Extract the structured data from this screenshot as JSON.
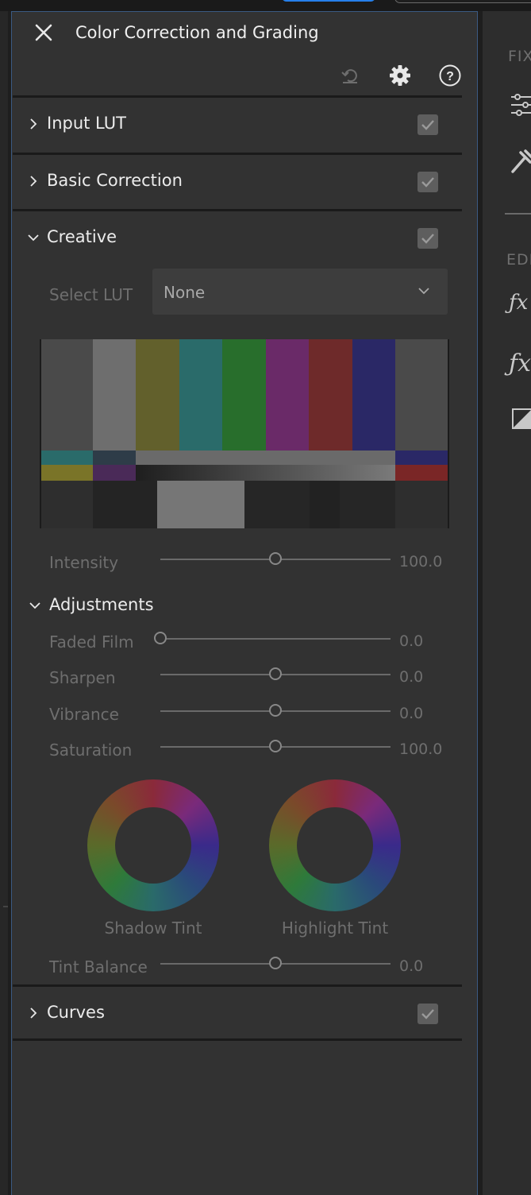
{
  "panel": {
    "title": "Color Correction and Grading",
    "header_icons": [
      "close-icon",
      "reset-icon",
      "gear-icon",
      "help-icon"
    ]
  },
  "sections": {
    "input_lut": {
      "label": "Input LUT",
      "enabled": true,
      "expanded": false
    },
    "basic_correction": {
      "label": "Basic Correction",
      "enabled": true,
      "expanded": false
    },
    "creative": {
      "label": "Creative",
      "enabled": true,
      "expanded": true,
      "select_lut": {
        "label": "Select LUT",
        "value": "None"
      },
      "intensity": {
        "label": "Intensity",
        "value": "100.0",
        "level": 0.5
      },
      "adjustments": {
        "label": "Adjustments",
        "faded_film": {
          "label": "Faded Film",
          "value": "0.0",
          "level": 0.0
        },
        "sharpen": {
          "label": "Sharpen",
          "value": "0.0",
          "level": 0.5
        },
        "vibrance": {
          "label": "Vibrance",
          "value": "0.0",
          "level": 0.5
        },
        "saturation": {
          "label": "Saturation",
          "value": "100.0",
          "level": 0.5
        },
        "shadow_tint": {
          "label": "Shadow Tint"
        },
        "highlight_tint": {
          "label": "Highlight Tint"
        },
        "tint_balance": {
          "label": "Tint Balance",
          "value": "0.0",
          "level": 0.5
        }
      }
    },
    "curves": {
      "label": "Curves",
      "enabled": true,
      "expanded": false
    }
  },
  "right_panel": {
    "label_top": "FIX",
    "label_edit": "EDI",
    "icons": [
      "sliders-icon",
      "wrench-icon",
      "fx-pen-icon",
      "fx-icon",
      "contrast-icon"
    ]
  },
  "colors": {
    "accent_border": "#3b5a82",
    "panel_bg": "#323232",
    "top_button": "#2680eb"
  }
}
